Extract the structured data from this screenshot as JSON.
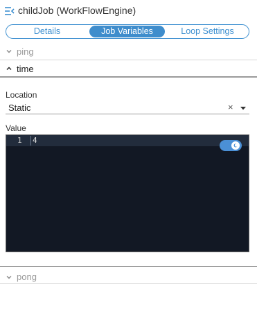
{
  "header": {
    "title": "childJob (WorkFlowEngine)",
    "menu_icon": "menu-collapse-icon"
  },
  "tabs": [
    {
      "label": "Details",
      "active": false
    },
    {
      "label": "Job Variables",
      "active": true
    },
    {
      "label": "Loop Settings",
      "active": false
    }
  ],
  "sections": {
    "ping": {
      "label": "ping",
      "expanded": false
    },
    "time": {
      "label": "time",
      "expanded": true
    },
    "pong": {
      "label": "pong",
      "expanded": false
    }
  },
  "location": {
    "label": "Location",
    "value": "Static",
    "clear_symbol": "×"
  },
  "value": {
    "label": "Value",
    "line_number": "1",
    "code": "4",
    "theme_toggle_on": true
  },
  "colors": {
    "accent": "#3f8dcc",
    "editor_bg": "#121824",
    "toggle": "#4b90d6"
  }
}
